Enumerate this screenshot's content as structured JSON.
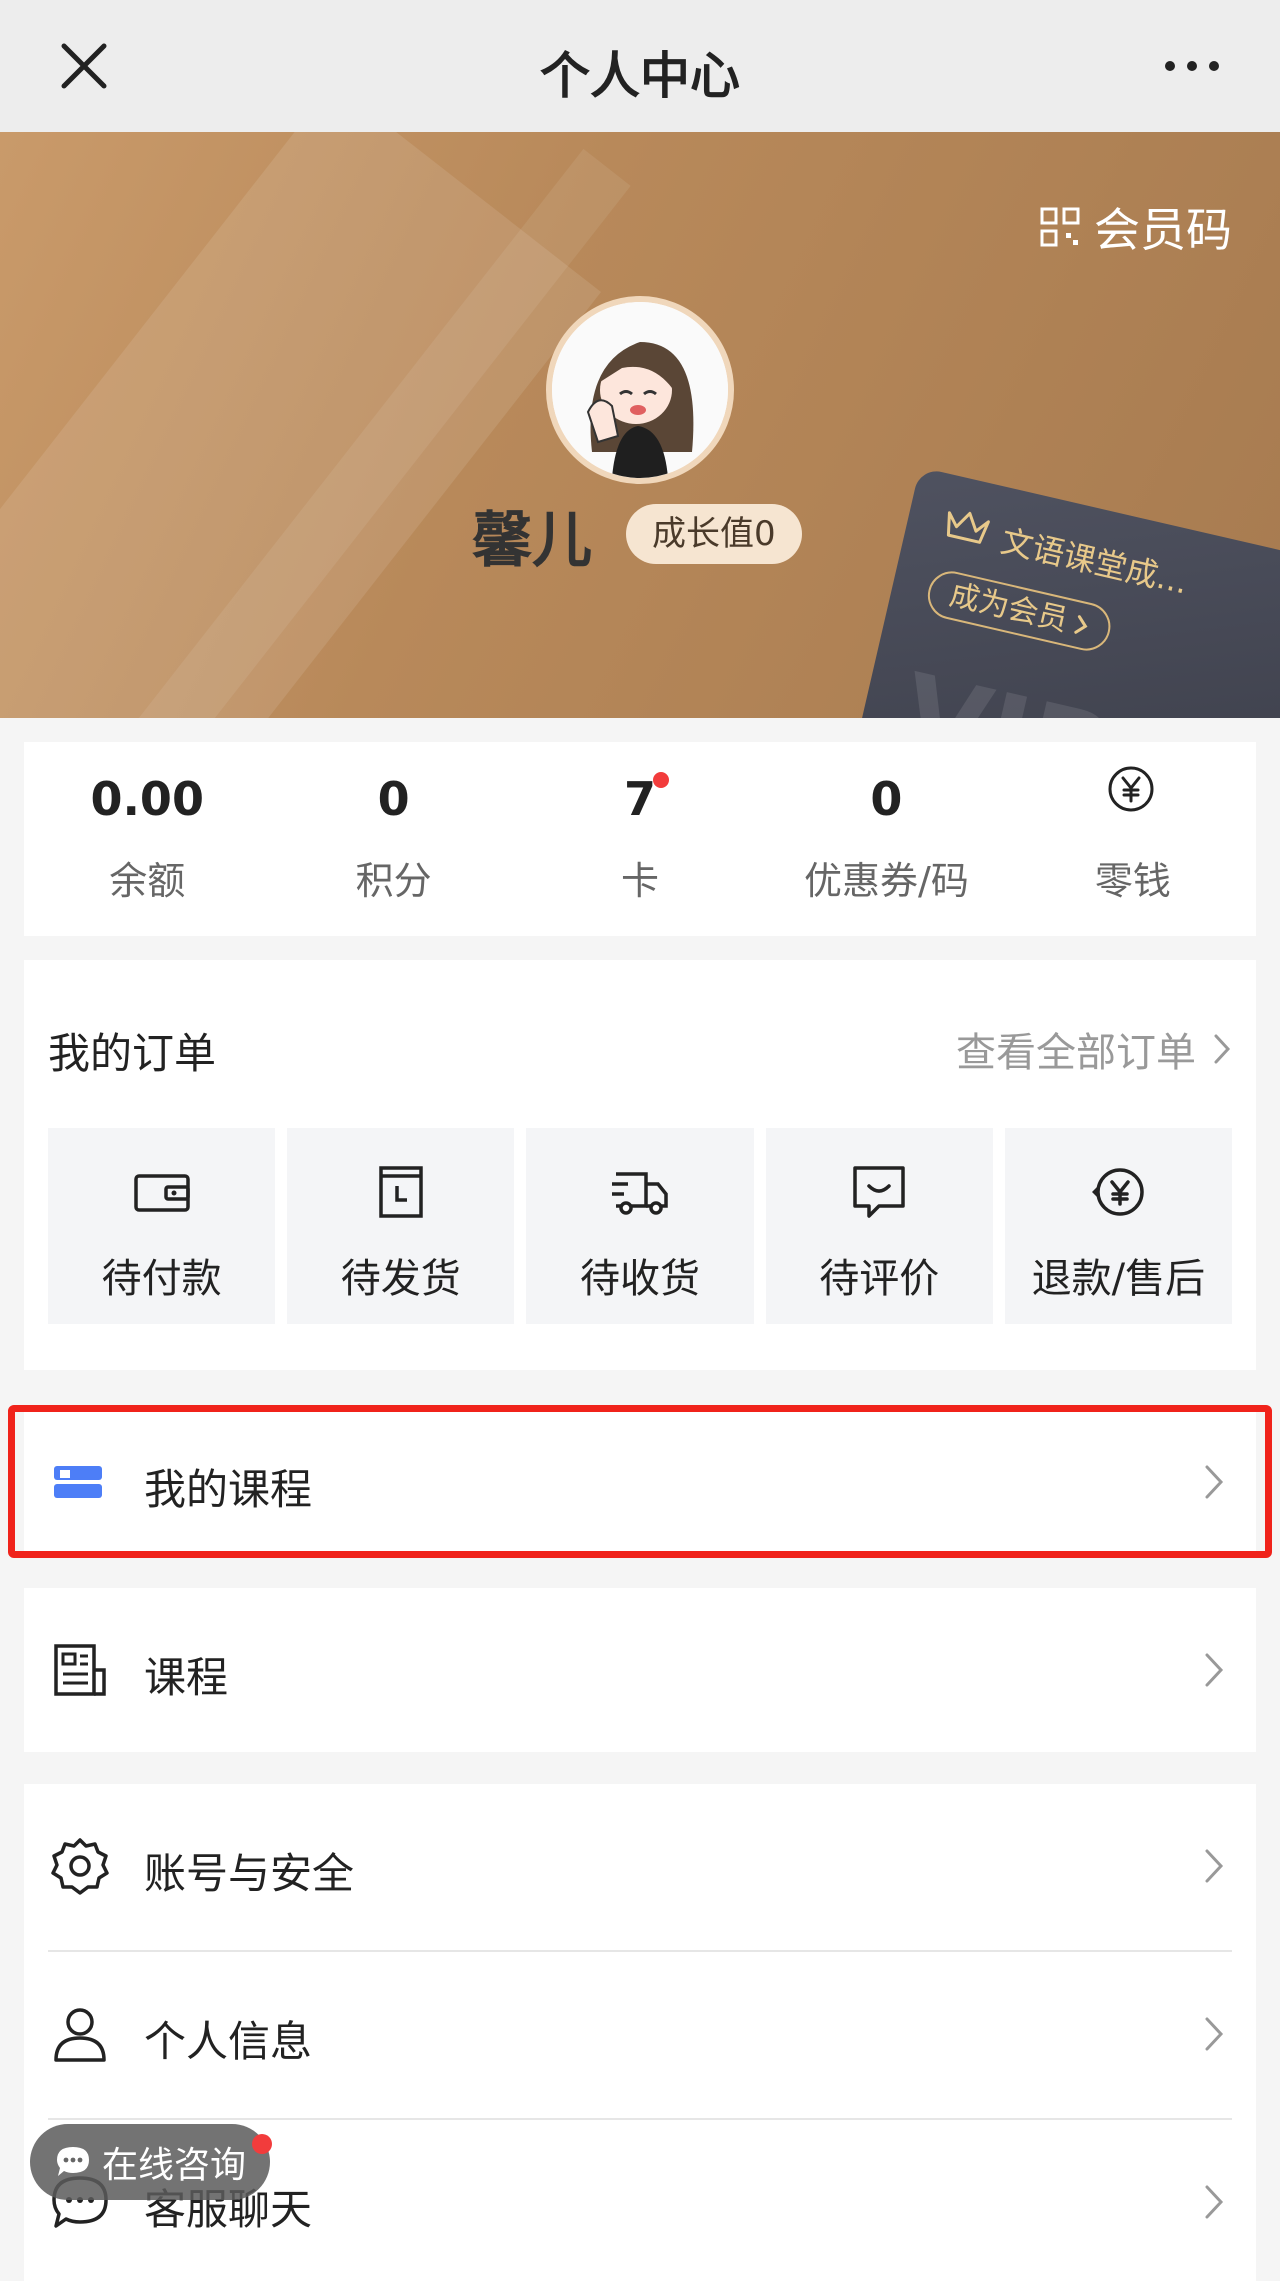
{
  "navbar": {
    "title": "个人中心"
  },
  "hero": {
    "member_code_label": "会员码",
    "username": "馨儿",
    "growth_badge": "成长值0",
    "vip_card": {
      "title": "文语课堂成...",
      "join_label": "成为会员",
      "watermark": "VIP"
    }
  },
  "stats": [
    {
      "value": "0.00",
      "label": "余额"
    },
    {
      "value": "0",
      "label": "积分"
    },
    {
      "value": "7",
      "label": "卡",
      "has_dot": true
    },
    {
      "value": "0",
      "label": "优惠券/码"
    },
    {
      "icon": "yuan-circle-icon",
      "label": "零钱"
    }
  ],
  "orders": {
    "title": "我的订单",
    "view_all": "查看全部订单",
    "items": [
      {
        "label": "待付款",
        "icon": "wallet-icon"
      },
      {
        "label": "待发货",
        "icon": "package-clock-icon"
      },
      {
        "label": "待收货",
        "icon": "truck-icon"
      },
      {
        "label": "待评价",
        "icon": "smile-comment-icon"
      },
      {
        "label": "退款/售后",
        "icon": "refund-icon"
      }
    ]
  },
  "menu": {
    "my_courses": "我的课程",
    "courses": "课程",
    "account_security": "账号与安全",
    "personal_info": "个人信息",
    "customer_chat": "客服聊天"
  },
  "consult": {
    "label": "在线咨询"
  },
  "colors": {
    "accent_red": "#f0231b",
    "hero_gold": "#b8895a",
    "vip_gold": "#e8c98a"
  }
}
